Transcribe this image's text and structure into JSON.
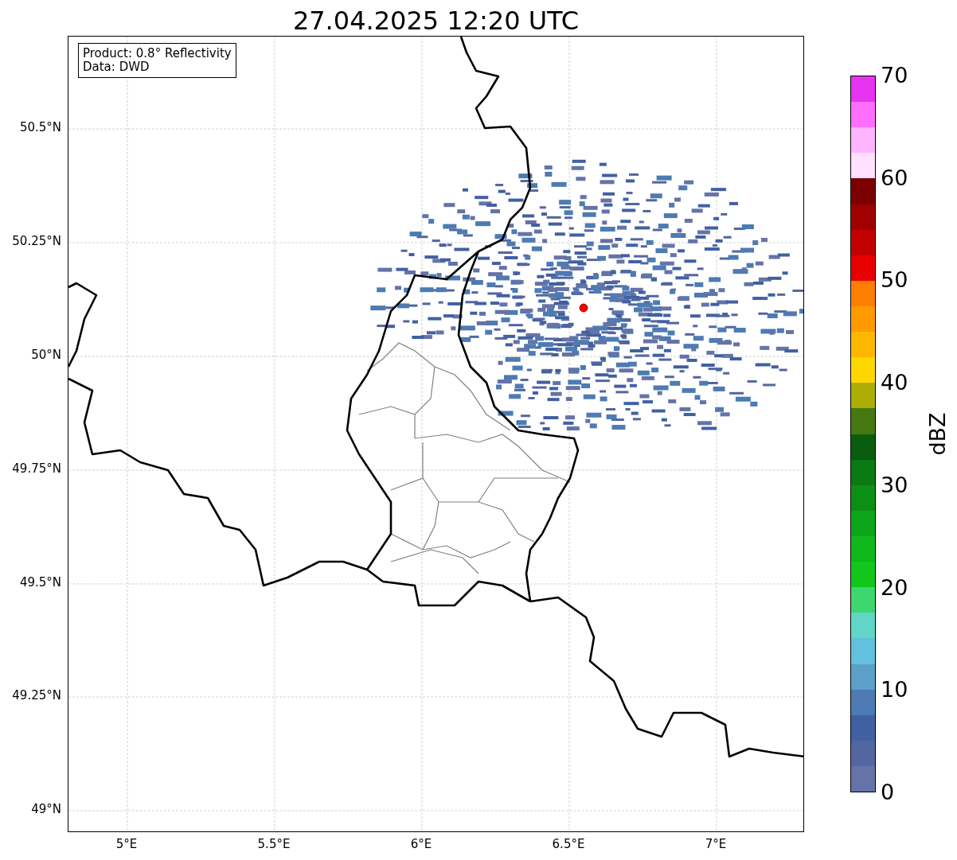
{
  "title": "27.04.2025 12:20 UTC",
  "info_box": [
    "Product: 0.8° Reflectivity",
    "Data: DWD"
  ],
  "map": {
    "x_ticks": [
      "5°E",
      "5.5°E",
      "6°E",
      "6.5°E",
      "7°E"
    ],
    "y_ticks": [
      "50.5°N",
      "50.25°N",
      "50°N",
      "49.75°N",
      "49.5°N",
      "49.25°N",
      "49°N"
    ]
  },
  "colorbar": {
    "label": "dBZ",
    "ticks": [
      "70",
      "60",
      "50",
      "40",
      "30",
      "20",
      "10",
      "0"
    ],
    "segments": [
      {
        "color": "#e633f0"
      },
      {
        "color": "#ff6eff"
      },
      {
        "color": "#ffb4ff"
      },
      {
        "color": "#ffe0ff"
      },
      {
        "color": "#7a0000"
      },
      {
        "color": "#a10000"
      },
      {
        "color": "#c20000"
      },
      {
        "color": "#e60000"
      },
      {
        "color": "#ff7e00"
      },
      {
        "color": "#ff9a00"
      },
      {
        "color": "#ffb600"
      },
      {
        "color": "#ffd700"
      },
      {
        "color": "#adad06"
      },
      {
        "color": "#457811"
      },
      {
        "color": "#0a5c0f"
      },
      {
        "color": "#0b7a14"
      },
      {
        "color": "#0c8f17"
      },
      {
        "color": "#0da519"
      },
      {
        "color": "#0fb81c"
      },
      {
        "color": "#11c71c"
      },
      {
        "color": "#3dd670"
      },
      {
        "color": "#62d6c6"
      },
      {
        "color": "#62c1dc"
      },
      {
        "color": "#5ba0c8"
      },
      {
        "color": "#4d7bb3"
      },
      {
        "color": "#4160a2"
      },
      {
        "color": "#5366a0"
      },
      {
        "color": "#6573a8"
      }
    ]
  }
}
